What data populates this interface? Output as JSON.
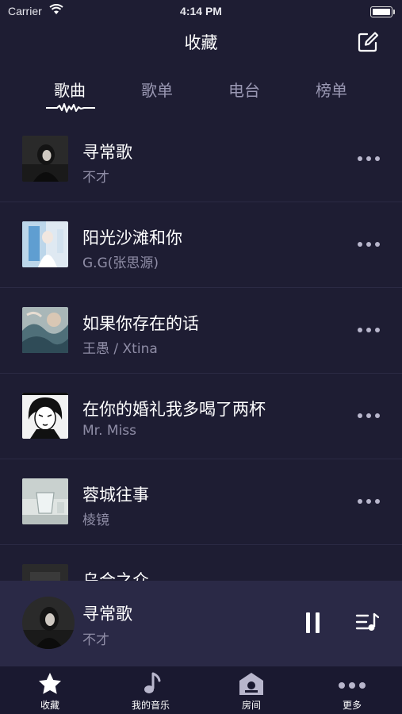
{
  "status_bar": {
    "carrier": "Carrier",
    "time": "4:14 PM"
  },
  "navbar": {
    "title": "收藏",
    "edit_icon": "edit-icon"
  },
  "tabs": [
    {
      "label": "歌曲",
      "active": true
    },
    {
      "label": "歌单",
      "active": false
    },
    {
      "label": "电台",
      "active": false
    },
    {
      "label": "榜单",
      "active": false
    }
  ],
  "songs": [
    {
      "title": "寻常歌",
      "artist": "不才"
    },
    {
      "title": "阳光沙滩和你",
      "artist": "G.G(张思源)"
    },
    {
      "title": "如果你存在的话",
      "artist": "王愚 / Xtina"
    },
    {
      "title": "在你的婚礼我多喝了两杯",
      "artist": "Mr. Miss"
    },
    {
      "title": "蓉城往事",
      "artist": "棱镜"
    },
    {
      "title": "乌合之众",
      "artist": ""
    }
  ],
  "now_playing": {
    "title": "寻常歌",
    "artist": "不才",
    "state": "playing"
  },
  "tab_bar": [
    {
      "label": "收藏",
      "icon": "star-icon"
    },
    {
      "label": "我的音乐",
      "icon": "music-note-icon"
    },
    {
      "label": "房间",
      "icon": "house-icon"
    },
    {
      "label": "更多",
      "icon": "more-icon"
    }
  ],
  "colors": {
    "background": "#1e1d33",
    "player": "#2a2946",
    "tabbar": "#1a1930",
    "secondary_text": "#8f8da6"
  }
}
